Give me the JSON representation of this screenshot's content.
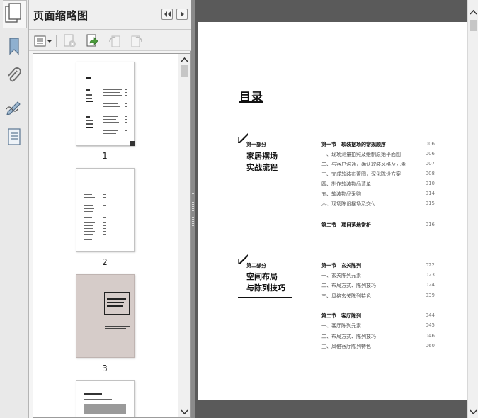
{
  "panel": {
    "title": "页面缩略图"
  },
  "thumbnails": [
    {
      "page": "1"
    },
    {
      "page": "2"
    },
    {
      "page": "3"
    },
    {
      "page": ""
    }
  ],
  "contents_page": {
    "title": "目录",
    "parts": [
      {
        "label": "第一部分",
        "title_line1": "家居摆场",
        "title_line2": "实战流程",
        "entries": [
          {
            "text": "第一节　软装摆场的常规顺序",
            "page": "006",
            "heading": true
          },
          {
            "text": "一、现场测量拍照及绘制原始平面图",
            "page": "006"
          },
          {
            "text": "二、与客户沟通，确认软装风格及元素",
            "page": "007"
          },
          {
            "text": "三、完成软装布置图，深化陈设方案",
            "page": "008"
          },
          {
            "text": "四、制作软装物品清单",
            "page": "010"
          },
          {
            "text": "五、软装物品采购",
            "page": "014"
          },
          {
            "text": "六、现场陈设摆场及交付",
            "page": "015"
          },
          {
            "text": "第二节　项目落地赏析",
            "page": "016",
            "heading": true
          }
        ]
      },
      {
        "label": "第二部分",
        "title_line1": "空间布局",
        "title_line2": "与陈列技巧",
        "entries": [
          {
            "text": "第一节　玄关陈列",
            "page": "022",
            "heading": true
          },
          {
            "text": "一、玄关陈列元素",
            "page": "023"
          },
          {
            "text": "二、布局方式、陈列技巧",
            "page": "024"
          },
          {
            "text": "三、风格玄关陈列特色",
            "page": "039"
          },
          {
            "text": "第二节　客厅陈列",
            "page": "044",
            "heading": true
          },
          {
            "text": "一、客厅陈列元素",
            "page": "045"
          },
          {
            "text": "二、布局方式、陈列技巧",
            "page": "046"
          },
          {
            "text": "三、风格客厅陈列特色",
            "page": "060"
          }
        ]
      }
    ]
  },
  "icons": {
    "panel": "pages-panel-icon",
    "collapse": "double-left-arrow-icon",
    "expand": "right-arrow-icon",
    "options": "thumbnail-options-icon",
    "delete": "delete-pages-icon",
    "insert": "insert-pages-icon",
    "rotate_ccw": "rotate-ccw-icon",
    "rotate_cw": "rotate-cw-icon"
  },
  "colors": {
    "document_background": "#5a5a5a",
    "panel_background": "#f4f4f4",
    "thumbnail_3_background": "#d6ccc9"
  }
}
